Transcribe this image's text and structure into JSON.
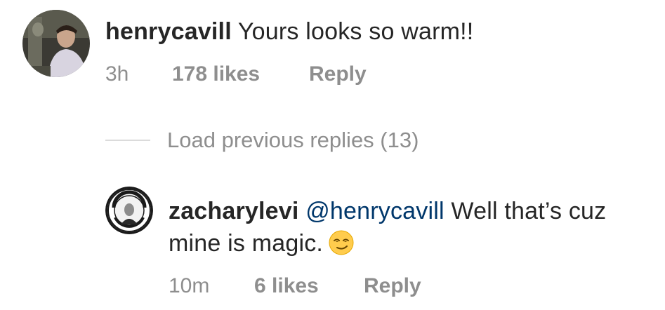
{
  "comments": [
    {
      "username": "henrycavill",
      "text": "Yours looks so warm!!",
      "time": "3h",
      "likes": "178 likes",
      "reply_label": "Reply"
    }
  ],
  "load_previous": {
    "label": "Load previous replies (13)"
  },
  "replies": [
    {
      "username": "zacharylevi",
      "mention": "@henrycavill",
      "text_line1": "Well that’s cuz",
      "text_line2": "mine is magic.",
      "emoji": "smirking-face-emoji",
      "time": "10m",
      "likes": "6 likes",
      "reply_label": "Reply"
    }
  ],
  "colors": {
    "text": "#262626",
    "meta": "#8e8e8e",
    "mention": "#00376b",
    "divider": "#dbdbdb"
  }
}
